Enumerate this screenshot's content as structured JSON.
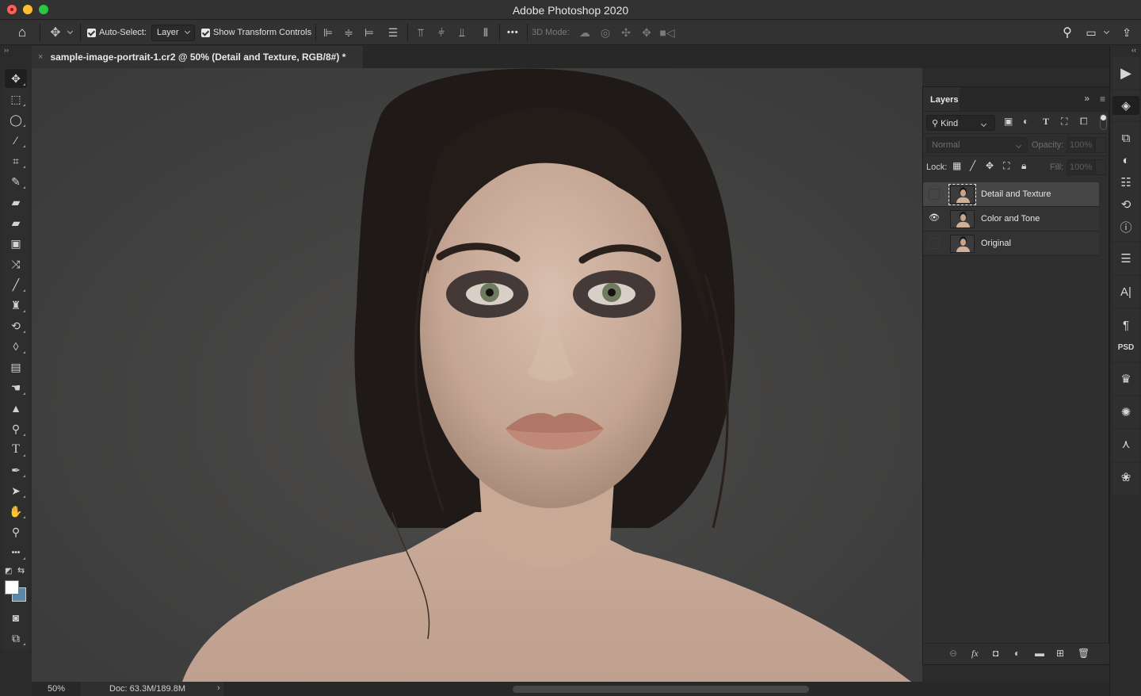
{
  "window": {
    "title": "Adobe Photoshop 2020"
  },
  "options_bar": {
    "auto_select_label": "Auto-Select:",
    "auto_select_checked": true,
    "auto_select_target": "Layer",
    "show_transform_label": "Show Transform Controls",
    "show_transform_checked": true,
    "mode_3d_label": "3D Mode:",
    "more_label": "•••",
    "icons": [
      "home-icon",
      "move-tool-icon",
      "align-left-edges-icon",
      "align-horizontal-centers-icon",
      "align-right-edges-icon",
      "distribute-horizontal-icon",
      "align-top-edges-icon",
      "align-vertical-centers-icon",
      "align-bottom-edges-icon",
      "distribute-vertical-icon",
      "orbit-3d-icon",
      "roll-3d-icon",
      "drag-3d-icon",
      "slide-3d-icon",
      "scale-3d-camera-icon",
      "search-icon",
      "workspace-icon",
      "share-icon"
    ]
  },
  "document": {
    "tab_title": "sample-image-portrait-1.cr2 @ 50% (Detail and Texture, RGB/8#) *",
    "close_glyph": "×",
    "canvas_description": "Portrait photo of a woman with dark hair and smoky eye makeup on a grey background"
  },
  "toolbox": {
    "collapse_glyph": "››",
    "tools": [
      {
        "name": "move-tool",
        "glyph": "✥"
      },
      {
        "name": "rectangular-marquee-tool",
        "glyph": "⬚"
      },
      {
        "name": "lasso-tool",
        "glyph": "◯"
      },
      {
        "name": "magic-wand-tool",
        "glyph": "⁄"
      },
      {
        "name": "crop-tool",
        "glyph": "⌗"
      },
      {
        "name": "eyedropper-tool",
        "glyph": "✎"
      },
      {
        "name": "spot-healing-brush-tool",
        "glyph": "▰"
      },
      {
        "name": "healing-brush-tool",
        "glyph": "▰"
      },
      {
        "name": "patch-tool",
        "glyph": "▣"
      },
      {
        "name": "content-aware-move-tool",
        "glyph": "⤨"
      },
      {
        "name": "brush-tool",
        "glyph": "╱"
      },
      {
        "name": "clone-stamp-tool",
        "glyph": "♜"
      },
      {
        "name": "history-brush-tool",
        "glyph": "⟲"
      },
      {
        "name": "eraser-tool",
        "glyph": "◊"
      },
      {
        "name": "gradient-tool",
        "glyph": "▤"
      },
      {
        "name": "smudge-tool",
        "glyph": "☚"
      },
      {
        "name": "sharpen-tool",
        "glyph": "▲"
      },
      {
        "name": "dodge-tool",
        "glyph": "⚲"
      },
      {
        "name": "type-tool",
        "glyph": "T"
      },
      {
        "name": "pen-tool",
        "glyph": "✒"
      },
      {
        "name": "path-selection-tool",
        "glyph": "➤"
      },
      {
        "name": "hand-tool",
        "glyph": "✋"
      },
      {
        "name": "zoom-tool",
        "glyph": "⚲"
      },
      {
        "name": "edit-toolbar",
        "glyph": "•••"
      }
    ],
    "foreground_color": "#ffffff",
    "background_color": "#5a8aa8"
  },
  "layers_panel": {
    "title": "Layers",
    "filter_kind": "Kind",
    "blend_mode": "Normal",
    "opacity_label": "Opacity:",
    "opacity_value": "100%",
    "lock_label": "Lock:",
    "fill_label": "Fill:",
    "fill_value": "100%",
    "layers": [
      {
        "name": "Detail and Texture",
        "visible": false,
        "selected": true
      },
      {
        "name": "Color and Tone",
        "visible": true,
        "selected": false
      },
      {
        "name": "Original",
        "visible": false,
        "selected": false
      }
    ],
    "footer_icons": [
      "link-layers-icon",
      "fx-icon",
      "add-mask-icon",
      "adjustment-layer-icon",
      "new-group-icon",
      "new-layer-icon",
      "delete-layer-icon"
    ]
  },
  "status_bar": {
    "zoom": "50%",
    "doc_info": "Doc: 63.3M/189.8M",
    "more_glyph": "›"
  },
  "dock": {
    "collapse_glyph": "‹‹",
    "panels": [
      "actions",
      "layers",
      "libraries",
      "adjustments",
      "properties",
      "history",
      "info",
      "tool-presets",
      "character",
      "paragraph",
      "psd-cloud",
      "histogram",
      "navigator",
      "paths",
      "channels"
    ]
  }
}
